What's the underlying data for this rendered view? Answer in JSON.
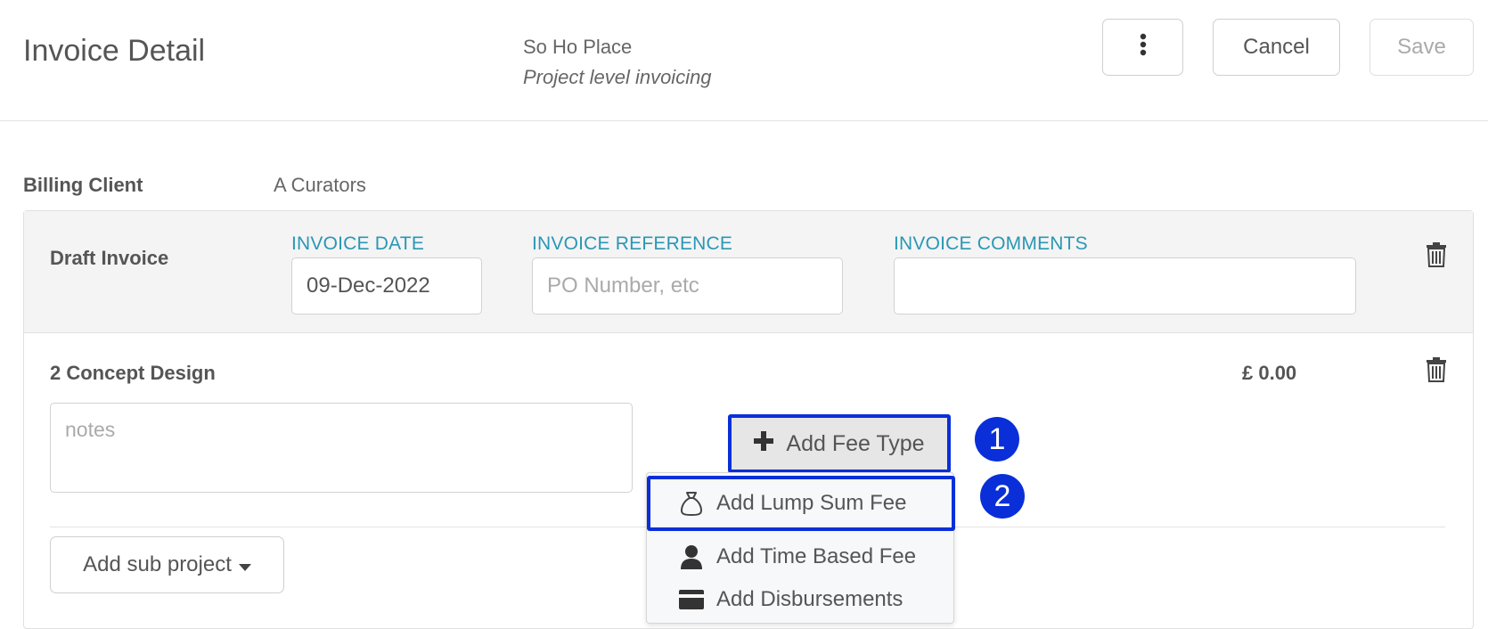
{
  "header": {
    "title": "Invoice Detail",
    "project_name": "So Ho Place",
    "project_subtitle": "Project level invoicing",
    "kebab_icon": "⋮",
    "cancel_label": "Cancel",
    "save_label": "Save"
  },
  "billing": {
    "label": "Billing Client",
    "value": "A Curators"
  },
  "draft_invoice": {
    "title": "Draft Invoice",
    "date_label": "INVOICE DATE",
    "date_value": "09-Dec-2022",
    "reference_label": "INVOICE REFERENCE",
    "reference_placeholder": "PO Number, etc",
    "comments_label": "INVOICE COMMENTS",
    "comments_value": ""
  },
  "section": {
    "title": "2 Concept Design",
    "amount": "£ 0.00",
    "notes_placeholder": "notes",
    "add_fee_label": "Add Fee Type",
    "add_subproject_label": "Add sub project"
  },
  "fee_menu": {
    "items": [
      {
        "label": "Add Lump Sum Fee",
        "icon": "money-bag-icon"
      },
      {
        "label": "Add Time Based Fee",
        "icon": "person-icon"
      },
      {
        "label": "Add Disbursements",
        "icon": "card-icon"
      }
    ]
  },
  "markers": {
    "first": "1",
    "second": "2"
  },
  "colors": {
    "accent_label": "#2a97b5",
    "highlight": "#0a2fd8"
  }
}
